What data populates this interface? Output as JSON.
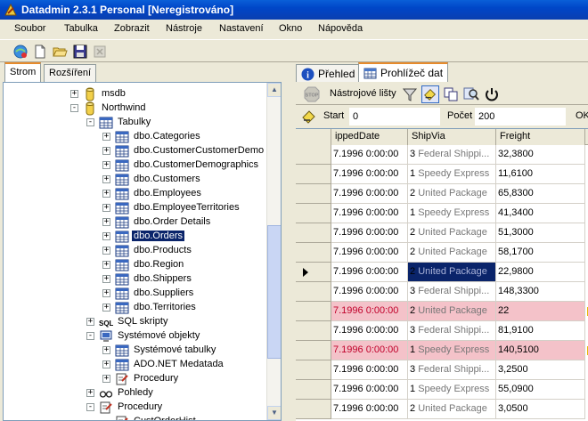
{
  "window": {
    "title": "Datadmin 2.3.1 Personal [Neregistrováno]"
  },
  "menu": [
    "Soubor",
    "Tabulka",
    "Zobrazit",
    "Nástroje",
    "Nastavení",
    "Okno",
    "Nápověda"
  ],
  "toolbar_icons": [
    "connect-icon",
    "new-file-icon",
    "open-folder-icon",
    "save-icon",
    "disabled-tool-icon"
  ],
  "left_tabs": {
    "tree": "Strom",
    "extensions": "Rozšíření"
  },
  "tree": [
    {
      "label": "msdb",
      "icon": "database-icon",
      "level": 1,
      "expander": "+"
    },
    {
      "label": "Northwind",
      "icon": "database-icon",
      "level": 1,
      "expander": "-"
    },
    {
      "label": "Tabulky",
      "icon": "tables-icon",
      "level": 2,
      "expander": "-"
    },
    {
      "label": "dbo.Categories",
      "icon": "table-icon",
      "level": 3,
      "expander": "+"
    },
    {
      "label": "dbo.CustomerCustomerDemo",
      "icon": "table-icon",
      "level": 3,
      "expander": "+"
    },
    {
      "label": "dbo.CustomerDemographics",
      "icon": "table-icon",
      "level": 3,
      "expander": "+"
    },
    {
      "label": "dbo.Customers",
      "icon": "table-icon",
      "level": 3,
      "expander": "+"
    },
    {
      "label": "dbo.Employees",
      "icon": "table-icon",
      "level": 3,
      "expander": "+"
    },
    {
      "label": "dbo.EmployeeTerritories",
      "icon": "table-icon",
      "level": 3,
      "expander": "+"
    },
    {
      "label": "dbo.Order Details",
      "icon": "table-icon",
      "level": 3,
      "expander": "+"
    },
    {
      "label": "dbo.Orders",
      "icon": "table-icon",
      "level": 3,
      "expander": "+",
      "selected": true
    },
    {
      "label": "dbo.Products",
      "icon": "table-icon",
      "level": 3,
      "expander": "+"
    },
    {
      "label": "dbo.Region",
      "icon": "table-icon",
      "level": 3,
      "expander": "+"
    },
    {
      "label": "dbo.Shippers",
      "icon": "table-icon",
      "level": 3,
      "expander": "+"
    },
    {
      "label": "dbo.Suppliers",
      "icon": "table-icon",
      "level": 3,
      "expander": "+"
    },
    {
      "label": "dbo.Territories",
      "icon": "table-icon",
      "level": 3,
      "expander": "+"
    },
    {
      "label": "SQL skripty",
      "icon": "sql-icon",
      "level": 2,
      "expander": "+"
    },
    {
      "label": "Systémové objekty",
      "icon": "system-objects-icon",
      "level": 2,
      "expander": "-"
    },
    {
      "label": "Systémové tabulky",
      "icon": "tables-icon",
      "level": 3,
      "expander": "+"
    },
    {
      "label": "ADO.NET Medatada",
      "icon": "table-icon",
      "level": 3,
      "expander": "+"
    },
    {
      "label": "Procedury",
      "icon": "procedure-icon",
      "level": 3,
      "expander": "+"
    },
    {
      "label": "Pohledy",
      "icon": "views-icon",
      "level": 2,
      "expander": "+"
    },
    {
      "label": "Procedury",
      "icon": "procedure-icon",
      "level": 2,
      "expander": "-"
    },
    {
      "label": "CustOrderHist",
      "icon": "procedure-icon",
      "level": 3,
      "expander": ""
    }
  ],
  "right_tabs": {
    "overview": "Přehled",
    "data_browser": "Prohlížeč dat"
  },
  "grid_toolbar": {
    "label": "Nástrojové lišty"
  },
  "paging": {
    "start_label": "Start",
    "start_value": "0",
    "count_label": "Počet",
    "count_value": "200",
    "ok_label": "OK"
  },
  "grid": {
    "columns": [
      "ippedDate",
      "ShipVia",
      "Freight"
    ],
    "rows": [
      {
        "date": "7.1996 0:00:00",
        "via_num": "3",
        "via_name": "Federal Shippi...",
        "freight": "32,3800"
      },
      {
        "date": "7.1996 0:00:00",
        "via_num": "1",
        "via_name": "Speedy Express",
        "freight": "11,6100"
      },
      {
        "date": "7.1996 0:00:00",
        "via_num": "2",
        "via_name": "United Package",
        "freight": "65,8300"
      },
      {
        "date": "7.1996 0:00:00",
        "via_num": "1",
        "via_name": "Speedy Express",
        "freight": "41,3400"
      },
      {
        "date": "7.1996 0:00:00",
        "via_num": "2",
        "via_name": "United Package",
        "freight": "51,3000"
      },
      {
        "date": "7.1996 0:00:00",
        "via_num": "2",
        "via_name": "United Package",
        "freight": "58,1700"
      },
      {
        "date": "7.1996 0:00:00",
        "via_num": "2",
        "via_name": "United Package",
        "freight": "22,9800",
        "current": true
      },
      {
        "date": "7.1996 0:00:00",
        "via_num": "3",
        "via_name": "Federal Shippi...",
        "freight": "148,3300"
      },
      {
        "date": "7.1996 0:00:00",
        "via_num": "2",
        "via_name": "United Package",
        "freight": "22",
        "highlight": true
      },
      {
        "date": "7.1996 0:00:00",
        "via_num": "3",
        "via_name": "Federal Shippi...",
        "freight": "81,9100"
      },
      {
        "date": "7.1996 0:00:00",
        "via_num": "1",
        "via_name": "Speedy Express",
        "freight": "140,5100",
        "highlight": true
      },
      {
        "date": "7.1996 0:00:00",
        "via_num": "3",
        "via_name": "Federal Shippi...",
        "freight": "3,2500"
      },
      {
        "date": "7.1996 0:00:00",
        "via_num": "1",
        "via_name": "Speedy Express",
        "freight": "55,0900"
      },
      {
        "date": "7.1996 0:00:00",
        "via_num": "2",
        "via_name": "United Package",
        "freight": "3,0500"
      }
    ]
  },
  "colors": {
    "title_bar": "#0046c8",
    "selection": "#0a246a",
    "highlight_row": "#f4c2c9",
    "active_tab_accent": "#e68b2c"
  }
}
